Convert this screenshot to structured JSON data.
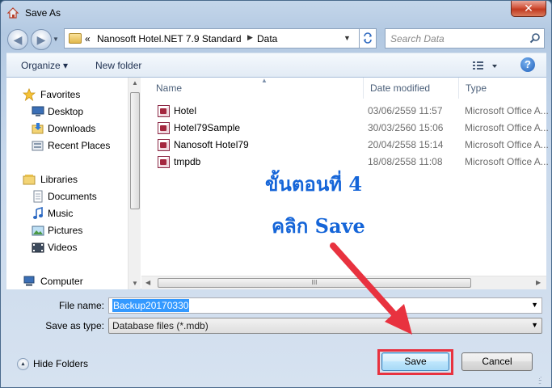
{
  "window": {
    "title": "Save As",
    "close_glyph": "✕"
  },
  "nav": {
    "back_glyph": "◀",
    "forward_glyph": "▶",
    "address_overflow": "«",
    "breadcrumb": [
      "Nanosoft Hotel.NET 7.9 Standard",
      "Data"
    ],
    "search_placeholder": "Search Data"
  },
  "toolbar": {
    "organize_label": "Organize ▾",
    "new_folder_label": "New folder",
    "help_glyph": "?"
  },
  "sidebar": {
    "items": [
      {
        "label": "Favorites",
        "icon": "star-icon"
      },
      {
        "label": "Desktop",
        "icon": "desktop-icon"
      },
      {
        "label": "Downloads",
        "icon": "downloads-icon"
      },
      {
        "label": "Recent Places",
        "icon": "recent-places-icon"
      },
      {
        "label": "Libraries",
        "icon": "libraries-icon"
      },
      {
        "label": "Documents",
        "icon": "documents-icon"
      },
      {
        "label": "Music",
        "icon": "music-icon"
      },
      {
        "label": "Pictures",
        "icon": "pictures-icon"
      },
      {
        "label": "Videos",
        "icon": "videos-icon"
      },
      {
        "label": "Computer",
        "icon": "computer-icon"
      }
    ]
  },
  "file_list": {
    "columns": [
      "Name",
      "Date modified",
      "Type"
    ],
    "rows": [
      {
        "name": "Hotel",
        "date": "03/06/2559 11:57",
        "type": "Microsoft Office A..."
      },
      {
        "name": "Hotel79Sample",
        "date": "30/03/2560 15:06",
        "type": "Microsoft Office A..."
      },
      {
        "name": "Nanosoft Hotel79",
        "date": "20/04/2558 15:14",
        "type": "Microsoft Office A..."
      },
      {
        "name": "tmpdb",
        "date": "18/08/2558 11:08",
        "type": "Microsoft Office A..."
      }
    ]
  },
  "form": {
    "file_name_label": "File name:",
    "file_name_value": "Backup20170330",
    "save_as_type_label": "Save as type:",
    "save_as_type_value": "Database files (*.mdb)"
  },
  "footer": {
    "hide_folders_label": "Hide Folders",
    "save_label": "Save",
    "cancel_label": "Cancel"
  },
  "annotation": {
    "step_text": "ขั้นตอนที่ 4",
    "action_text": "คลิก Save",
    "color": "#1565d8",
    "arrow_color": "#e8323f"
  }
}
